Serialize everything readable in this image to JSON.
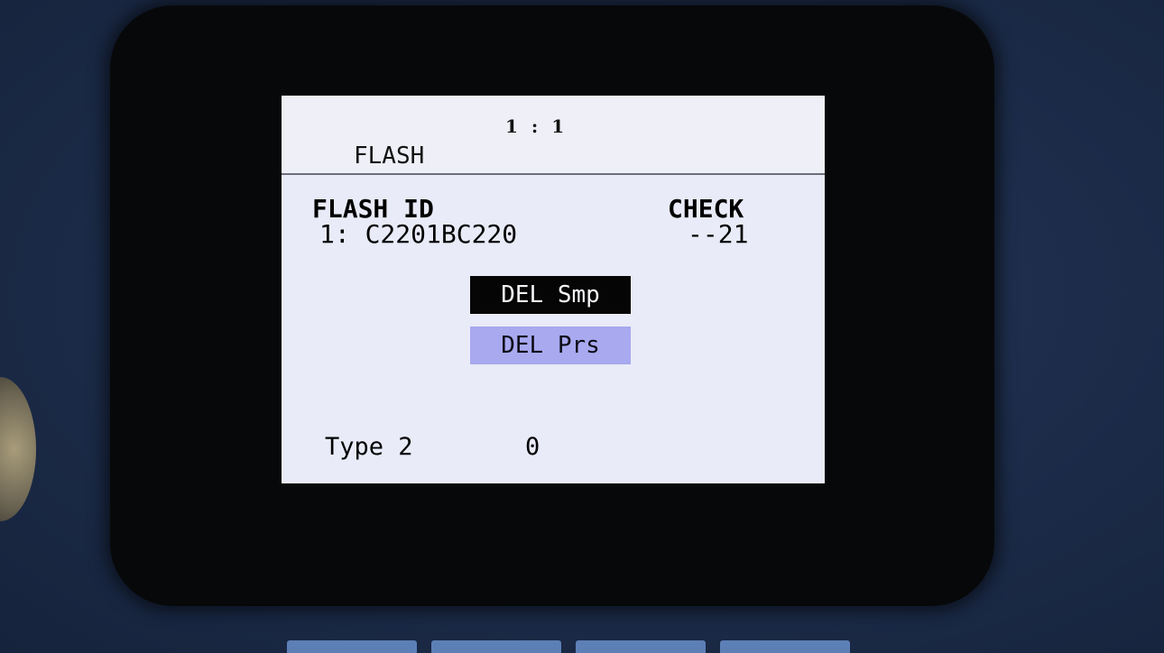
{
  "screen": {
    "position_readout": "1 : 1",
    "page_title": "FLASH"
  },
  "flash": {
    "id_label": "FLASH ID",
    "id_value": "1: C2201BC220",
    "check_label": "CHECK",
    "check_value": "--21"
  },
  "buttons": {
    "delete_samples": "DEL Smp",
    "delete_presets": "DEL Prs"
  },
  "footer": {
    "type_label": "Type 2",
    "type_value": "0"
  },
  "colors": {
    "screen_background": "#e9ebf8",
    "selected_button": "#050505",
    "secondary_button": "#a8a9ef",
    "device_panel": "#1d2d4b"
  }
}
